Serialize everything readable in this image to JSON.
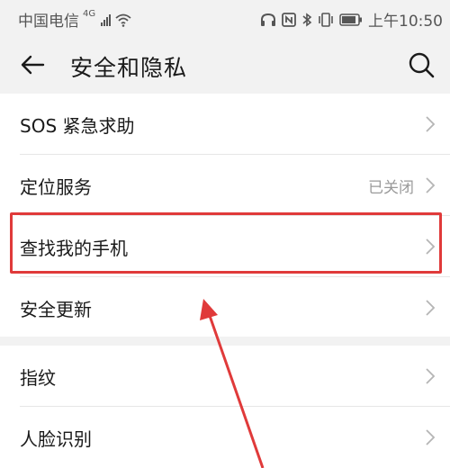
{
  "status_bar": {
    "carrier": "中国电信",
    "network": "4G",
    "time": "上午10:50"
  },
  "header": {
    "title": "安全和隐私"
  },
  "groups": [
    {
      "items": [
        {
          "label": "SOS 紧急求助",
          "value": ""
        },
        {
          "label": "定位服务",
          "value": "已关闭"
        },
        {
          "label": "查找我的手机",
          "value": ""
        },
        {
          "label": "安全更新",
          "value": ""
        }
      ]
    },
    {
      "items": [
        {
          "label": "指纹",
          "value": ""
        },
        {
          "label": "人脸识别",
          "value": ""
        }
      ]
    }
  ],
  "colors": {
    "highlight": "#e03a3a",
    "background": "#f2f2f2",
    "card": "#ffffff"
  },
  "icons": [
    "signal-icon",
    "wifi-icon",
    "headset-icon",
    "nfc-icon",
    "bluetooth-icon",
    "vibrate-icon",
    "battery-icon",
    "back-arrow-icon",
    "search-icon",
    "chevron-right-icon"
  ]
}
